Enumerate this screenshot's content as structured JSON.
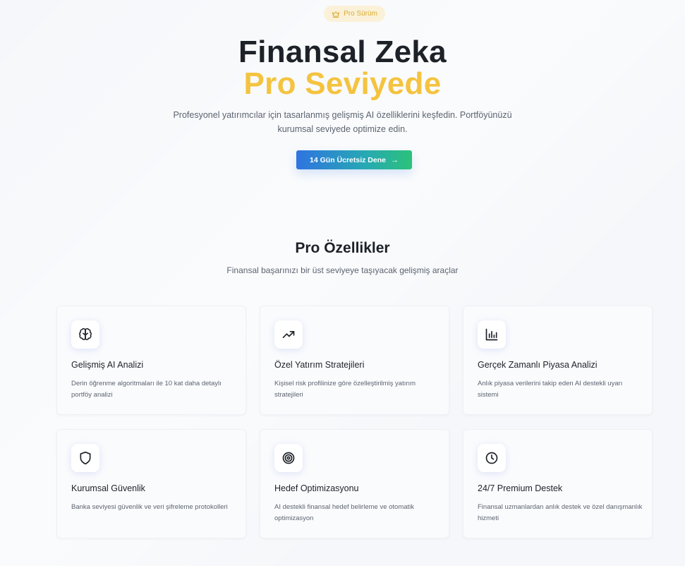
{
  "hero": {
    "badge_label": "Pro Sürüm",
    "badge_icon": "crown-icon",
    "title_line1": "Finansal Zeka",
    "title_line2": "Pro Seviyede",
    "subtitle": "Profesyonel yatırımcılar için tasarlanmış gelişmiş AI özelliklerini keşfedin. Portföyünüzü kurumsal seviyede optimize edin.",
    "cta_label": "14 Gün Ücretsiz Dene",
    "cta_arrow": "→"
  },
  "colors": {
    "accent_yellow": "#f4c33f",
    "badge_bg": "#fbf1d8",
    "cta_gradient_start": "#2f74e0",
    "cta_gradient_end": "#2bc27a",
    "text_dark": "#1d2128",
    "text_muted": "#5c6470"
  },
  "features": {
    "title": "Pro Özellikler",
    "subtitle": "Finansal başarınızı bir üst seviyeye taşıyacak gelişmiş araçlar",
    "cards": [
      {
        "icon": "brain-icon",
        "title": "Gelişmiş AI Analizi",
        "description": "Derin öğrenme algoritmaları ile 10 kat daha detaylı portföy analizi"
      },
      {
        "icon": "trending-up-icon",
        "title": "Özel Yatırım Stratejileri",
        "description": "Kişisel risk profilinize göre özelleştirilmiş yatırım stratejileri"
      },
      {
        "icon": "bar-chart-icon",
        "title": "Gerçek Zamanlı Piyasa Analizi",
        "description": "Anlık piyasa verilerini takip eden AI destekli uyarı sistemi"
      },
      {
        "icon": "shield-icon",
        "title": "Kurumsal Güvenlik",
        "description": "Banka seviyesi güvenlik ve veri şifreleme protokolleri"
      },
      {
        "icon": "target-icon",
        "title": "Hedef Optimizasyonu",
        "description": "AI destekli finansal hedef belirleme ve otomatik optimizasyon"
      },
      {
        "icon": "clock-icon",
        "title": "24/7 Premium Destek",
        "description": "Finansal uzmanlardan anlık destek ve özel danışmanlık hizmeti"
      }
    ]
  }
}
